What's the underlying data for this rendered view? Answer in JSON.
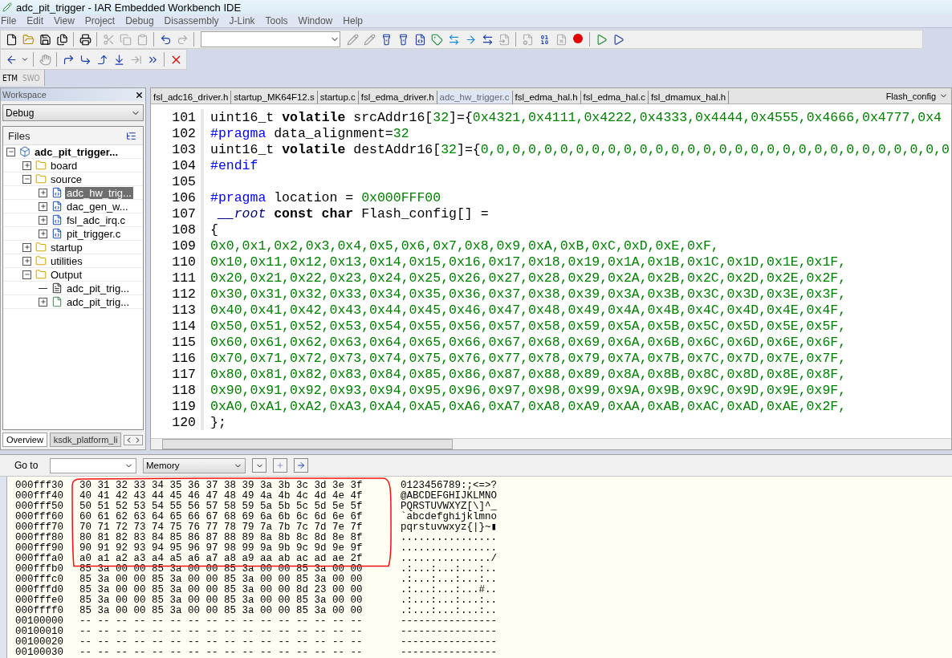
{
  "window": {
    "title": "adc_pit_trigger - IAR Embedded Workbench IDE"
  },
  "menu": [
    "File",
    "Edit",
    "View",
    "Project",
    "Debug",
    "Disassembly",
    "J-Link",
    "Tools",
    "Window",
    "Help"
  ],
  "trace_tabs": [
    {
      "label": "ETM",
      "disabled": false
    },
    {
      "label": "SWO",
      "disabled": true
    }
  ],
  "workspace": {
    "title": "Workspace",
    "configuration": "Debug",
    "files_header": "Files",
    "tree": [
      {
        "label": "adc_pit_trigger...",
        "kind": "project",
        "expanded": true,
        "selected": false,
        "children": [
          {
            "label": "board",
            "kind": "folder",
            "expanded": false,
            "selected": false
          },
          {
            "label": "source",
            "kind": "folder",
            "expanded": true,
            "selected": false,
            "children": [
              {
                "label": "adc_hw_trig...",
                "kind": "c-file",
                "expanded": false,
                "selected": true
              },
              {
                "label": "dac_gen_w...",
                "kind": "c-file",
                "expanded": false,
                "selected": false
              },
              {
                "label": "fsl_adc_irq.c",
                "kind": "c-file",
                "expanded": false,
                "selected": false
              },
              {
                "label": "pit_trigger.c",
                "kind": "c-file",
                "expanded": false,
                "selected": false
              }
            ]
          },
          {
            "label": "startup",
            "kind": "folder",
            "expanded": false,
            "selected": false
          },
          {
            "label": "utilities",
            "kind": "folder",
            "expanded": false,
            "selected": false
          },
          {
            "label": "Output",
            "kind": "folder",
            "expanded": true,
            "selected": false,
            "children": [
              {
                "label": "adc_pit_trig...",
                "kind": "text-file",
                "selected": false
              },
              {
                "label": "adc_pit_trig...",
                "kind": "binary-file",
                "expanded": false,
                "selected": false
              }
            ]
          }
        ]
      }
    ],
    "tabs": [
      {
        "label": "Overview",
        "selected": true
      },
      {
        "label": "ksdk_platform_li",
        "selected": false
      }
    ]
  },
  "editor": {
    "tabs": [
      {
        "label": "fsl_adc16_driver.h",
        "selected": false
      },
      {
        "label": "startup_MK64F12.s",
        "selected": false
      },
      {
        "label": "startup.c",
        "selected": false
      },
      {
        "label": "fsl_edma_driver.h",
        "selected": false
      },
      {
        "label": "adc_hw_trigger.c",
        "selected": true
      },
      {
        "label": "fsl_edma_hal.h",
        "selected": false
      },
      {
        "label": "fsl_edma_hal.c",
        "selected": false
      },
      {
        "label": "fsl_dmamux_hal.h",
        "selected": false
      }
    ],
    "function_list": "Flash_config",
    "lines": [
      {
        "number": "101",
        "segments": [
          {
            "text": "uint16_t ",
            "kind": "plain"
          },
          {
            "text": "volatile",
            "kind": "keyword"
          },
          {
            "text": " srcAddr16[",
            "kind": "plain"
          },
          {
            "text": "32",
            "kind": "number"
          },
          {
            "text": "]={",
            "kind": "plain"
          },
          {
            "text": "0x4321,0x4111,0x4222,0x4333,0x4444,0x4555,0x4666,0x4777,0x4",
            "kind": "number"
          }
        ]
      },
      {
        "number": "102",
        "segments": [
          {
            "text": "#pragma",
            "kind": "preproc"
          },
          {
            "text": " data_alignment=",
            "kind": "plain"
          },
          {
            "text": "32",
            "kind": "number"
          }
        ]
      },
      {
        "number": "103",
        "segments": [
          {
            "text": "uint16_t ",
            "kind": "plain"
          },
          {
            "text": "volatile",
            "kind": "keyword"
          },
          {
            "text": " destAddr16[",
            "kind": "plain"
          },
          {
            "text": "32",
            "kind": "number"
          },
          {
            "text": "]={",
            "kind": "plain"
          },
          {
            "text": "0,0,0,0,0,0,0,0,0,0,0,0,0,0,0,0,0,0,0,0,0,0,0,0,0,0,0,0,0,0,",
            "kind": "number"
          }
        ]
      },
      {
        "number": "104",
        "segments": [
          {
            "text": "#endif",
            "kind": "preproc"
          }
        ]
      },
      {
        "number": "105"
      },
      {
        "number": "106",
        "segments": [
          {
            "text": "#pragma",
            "kind": "preproc"
          },
          {
            "text": " location = ",
            "kind": "plain"
          },
          {
            "text": "0x000FFF00",
            "kind": "number"
          }
        ]
      },
      {
        "number": "107",
        "segments": [
          {
            "text": " __root",
            "kind": "italic"
          },
          {
            "text": " const char",
            "kind": "keyword"
          },
          {
            "text": " Flash_config[] =",
            "kind": "plain"
          }
        ]
      },
      {
        "number": "108",
        "segments": [
          {
            "text": "{",
            "kind": "plain"
          }
        ]
      },
      {
        "number": "109",
        "segments": [
          {
            "text": "0x0,0x1,0x2,0x3,0x4,0x5,0x6,0x7,0x8,0x9,0xA,0xB,0xC,0xD,0xE,0xF,",
            "kind": "number"
          }
        ]
      },
      {
        "number": "110",
        "segments": [
          {
            "text": "0x10,0x11,0x12,0x13,0x14,0x15,0x16,0x17,0x18,0x19,0x1A,0x1B,0x1C,0x1D,0x1E,0x1F,",
            "kind": "number"
          }
        ]
      },
      {
        "number": "111",
        "segments": [
          {
            "text": "0x20,0x21,0x22,0x23,0x24,0x25,0x26,0x27,0x28,0x29,0x2A,0x2B,0x2C,0x2D,0x2E,0x2F,",
            "kind": "number"
          }
        ]
      },
      {
        "number": "112",
        "segments": [
          {
            "text": "0x30,0x31,0x32,0x33,0x34,0x35,0x36,0x37,0x38,0x39,0x3A,0x3B,0x3C,0x3D,0x3E,0x3F,",
            "kind": "number"
          }
        ]
      },
      {
        "number": "113",
        "segments": [
          {
            "text": "0x40,0x41,0x42,0x43,0x44,0x45,0x46,0x47,0x48,0x49,0x4A,0x4B,0x4C,0x4D,0x4E,0x4F,",
            "kind": "number"
          }
        ]
      },
      {
        "number": "114",
        "segments": [
          {
            "text": "0x50,0x51,0x52,0x53,0x54,0x55,0x56,0x57,0x58,0x59,0x5A,0x5B,0x5C,0x5D,0x5E,0x5F,",
            "kind": "number"
          }
        ]
      },
      {
        "number": "115",
        "segments": [
          {
            "text": "0x60,0x61,0x62,0x63,0x64,0x65,0x66,0x67,0x68,0x69,0x6A,0x6B,0x6C,0x6D,0x6E,0x6F,",
            "kind": "number"
          }
        ]
      },
      {
        "number": "116",
        "segments": [
          {
            "text": "0x70,0x71,0x72,0x73,0x74,0x75,0x76,0x77,0x78,0x79,0x7A,0x7B,0x7C,0x7D,0x7E,0x7F,",
            "kind": "number"
          }
        ]
      },
      {
        "number": "117",
        "segments": [
          {
            "text": "0x80,0x81,0x82,0x83,0x84,0x85,0x86,0x87,0x88,0x89,0x8A,0x8B,0x8C,0x8D,0x8E,0x8F,",
            "kind": "number"
          }
        ]
      },
      {
        "number": "118",
        "segments": [
          {
            "text": "0x90,0x91,0x92,0x93,0x94,0x95,0x96,0x97,0x98,0x99,0x9A,0x9B,0x9C,0x9D,0x9E,0x9F,",
            "kind": "number"
          }
        ]
      },
      {
        "number": "119",
        "segments": [
          {
            "text": "0xA0,0xA1,0xA2,0xA3,0xA4,0xA5,0xA6,0xA7,0xA8,0xA9,0xAA,0xAB,0xAC,0xAD,0xAE,0x2F,",
            "kind": "number"
          }
        ]
      },
      {
        "number": "120",
        "segments": [
          {
            "text": "};",
            "kind": "plain"
          }
        ]
      }
    ]
  },
  "memory": {
    "goto_label": "Go to",
    "zone": "Memory",
    "rows": [
      {
        "address": "000fff30",
        "bytes": "30 31 32 33 34 35 36 37 38 39 3a 3b 3c 3d 3e 3f",
        "ascii": "0123456789:;<=>?"
      },
      {
        "address": "000fff40",
        "bytes": "40 41 42 43 44 45 46 47 48 49 4a 4b 4c 4d 4e 4f",
        "ascii": "@ABCDEFGHIJKLMNO"
      },
      {
        "address": "000fff50",
        "bytes": "50 51 52 53 54 55 56 57 58 59 5a 5b 5c 5d 5e 5f",
        "ascii": "PQRSTUVWXYZ[\\]^_"
      },
      {
        "address": "000fff60",
        "bytes": "60 61 62 63 64 65 66 67 68 69 6a 6b 6c 6d 6e 6f",
        "ascii": "`abcdefghijklmno"
      },
      {
        "address": "000fff70",
        "bytes": "70 71 72 73 74 75 76 77 78 79 7a 7b 7c 7d 7e 7f",
        "ascii": "pqrstuvwxyz{|}~▮"
      },
      {
        "address": "000fff80",
        "bytes": "80 81 82 83 84 85 86 87 88 89 8a 8b 8c 8d 8e 8f",
        "ascii": "................"
      },
      {
        "address": "000fff90",
        "bytes": "90 91 92 93 94 95 96 97 98 99 9a 9b 9c 9d 9e 9f",
        "ascii": "................"
      },
      {
        "address": "000fffa0",
        "bytes": "a0 a1 a2 a3 a4 a5 a6 a7 a8 a9 aa ab ac ad ae 2f",
        "ascii": ".............../"
      },
      {
        "address": "000fffb0",
        "bytes": "85 3a 00 00 85 3a 00 00 85 3a 00 00 85 3a 00 00",
        "ascii": ".:...:...:...:.."
      },
      {
        "address": "000fffc0",
        "bytes": "85 3a 00 00 85 3a 00 00 85 3a 00 00 85 3a 00 00",
        "ascii": ".:...:...:...:.."
      },
      {
        "address": "000fffd0",
        "bytes": "85 3a 00 00 85 3a 00 00 85 3a 00 00 8d 23 00 00",
        "ascii": ".:...:...:...#.."
      },
      {
        "address": "000fffe0",
        "bytes": "85 3a 00 00 85 3a 00 00 85 3a 00 00 85 3a 00 00",
        "ascii": ".:...:...:...:.."
      },
      {
        "address": "000ffff0",
        "bytes": "85 3a 00 00 85 3a 00 00 85 3a 00 00 85 3a 00 00",
        "ascii": ".:...:...:...:.."
      },
      {
        "address": "00100000",
        "bytes": "-- -- -- -- -- -- -- -- -- -- -- -- -- -- -- --",
        "ascii": "----------------"
      },
      {
        "address": "00100010",
        "bytes": "-- -- -- -- -- -- -- -- -- -- -- -- -- -- -- --",
        "ascii": "----------------"
      },
      {
        "address": "00100020",
        "bytes": "-- -- -- -- -- -- -- -- -- -- -- -- -- -- -- --",
        "ascii": "----------------"
      },
      {
        "address": "00100030",
        "bytes": "-- -- -- -- -- -- -- -- -- -- -- -- -- -- -- --",
        "ascii": "----------------"
      }
    ]
  }
}
